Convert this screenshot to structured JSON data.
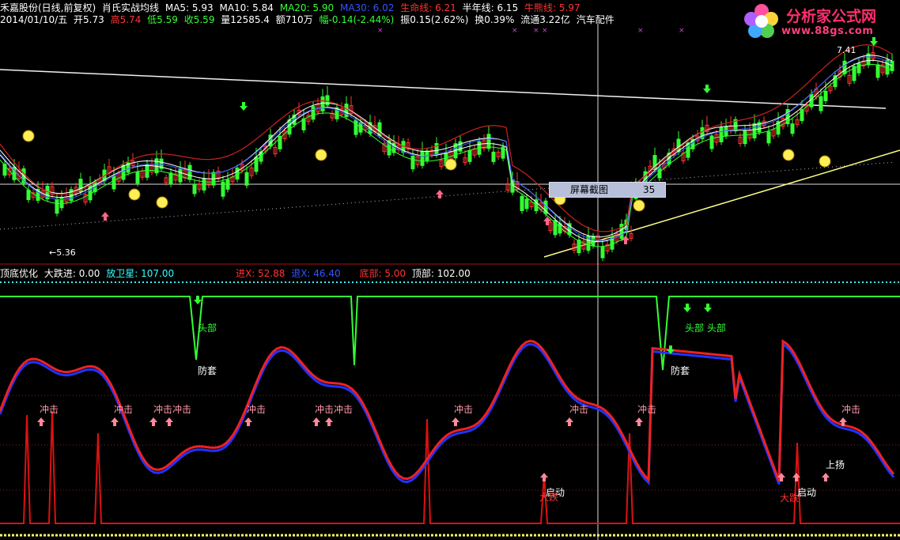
{
  "header": {
    "row1": [
      {
        "text": "禾嘉股份(日线,前复权)",
        "color": "#ffffff"
      },
      {
        "text": "肖氏实战均线",
        "color": "#ffffff"
      },
      {
        "text": "MA5: 5.93",
        "color": "#ffffff"
      },
      {
        "text": "MA10: 5.84",
        "color": "#ffffff"
      },
      {
        "text": "MA20: 5.90",
        "color": "#33ff33"
      },
      {
        "text": "MA30: 6.02",
        "color": "#3355ff"
      },
      {
        "text": "生命线: 6.21",
        "color": "#ff3333"
      },
      {
        "text": "半年线: 6.15",
        "color": "#ffffff"
      },
      {
        "text": "牛熊线: 5.97",
        "color": "#ff3333"
      }
    ],
    "row2": [
      {
        "text": "2014/01/10/五",
        "color": "#ffffff"
      },
      {
        "text": "开5.73",
        "color": "#ffffff"
      },
      {
        "text": "高5.74",
        "color": "#ff3333"
      },
      {
        "text": "低5.59",
        "color": "#33ff33"
      },
      {
        "text": "收5.59",
        "color": "#33ff33"
      },
      {
        "text": "量12585.4",
        "color": "#ffffff"
      },
      {
        "text": "额710万",
        "color": "#ffffff"
      },
      {
        "text": "幅-0.14(-2.44%)",
        "color": "#33ff33"
      },
      {
        "text": "振0.15(2.62%)",
        "color": "#ffffff"
      },
      {
        "text": "换0.39%",
        "color": "#ffffff"
      },
      {
        "text": "流通3.22亿",
        "color": "#ffffff"
      },
      {
        "text": "汽车配件",
        "color": "#ffffff"
      }
    ]
  },
  "price_labels": {
    "high": "7.41",
    "low": "←5.36"
  },
  "tooltip": {
    "label": "屏幕截图",
    "value": "35"
  },
  "logo": {
    "title": "分析家公式网",
    "url": "www.88gs.com"
  },
  "indicator_header": [
    {
      "text": "顶底优化",
      "color": "#ffffff"
    },
    {
      "text": "大跌进: 0.00",
      "color": "#ffffff"
    },
    {
      "text": "放卫星: 107.00",
      "color": "#33ffff"
    },
    {
      "text": "进X: 52.88",
      "color": "#ff3333"
    },
    {
      "text": "退X: 46.40",
      "color": "#3355ff"
    },
    {
      "text": "底部: 5.00",
      "color": "#ff3333"
    },
    {
      "text": "顶部: 102.00",
      "color": "#ffffff"
    }
  ],
  "signals": {
    "chongji": "冲击",
    "chongji_chongji": "冲击冲击",
    "toubu": "头部",
    "toubu_toubu": "头部 头部",
    "fangtao": "防套",
    "qidong": "启动",
    "dadie": "大跌",
    "shangyang": "上扬"
  },
  "colors": {
    "background": "#000000",
    "up": "#ff3333",
    "down": "#33ff33",
    "ma5": "#ffffff",
    "ma10": "#ffffff",
    "ma20": "#33ff33",
    "ma30": "#3355ff",
    "lifeline": "#cc2222",
    "cyan_line": "#33ffff",
    "signal_pink": "#ff99aa"
  }
}
